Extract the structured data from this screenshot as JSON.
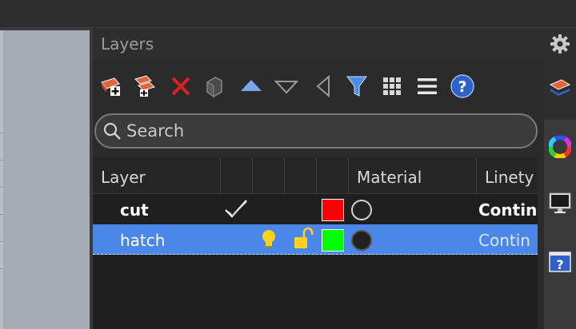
{
  "panel": {
    "title": "Layers"
  },
  "toolbar": {
    "icons": [
      "new-layer-icon",
      "new-sublayer-icon",
      "delete-icon",
      "layer-filter-icon",
      "move-up-icon",
      "move-down-icon",
      "move-left-icon",
      "filter-icon",
      "grid-icon",
      "menu-icon",
      "help-icon"
    ]
  },
  "search": {
    "placeholder": "Search"
  },
  "columns": {
    "layer": "Layer",
    "material": "Material",
    "linetype": "Linety"
  },
  "rows": [
    {
      "name": "cut",
      "current": true,
      "color": "#ff0000",
      "material_color": "#2a2a2a",
      "linetype": "Contin"
    },
    {
      "name": "hatch",
      "current": false,
      "color": "#00ff00",
      "material_color": "#222222",
      "linetype": "Contin"
    }
  ],
  "colors": {
    "accent": "#4a87e8"
  }
}
